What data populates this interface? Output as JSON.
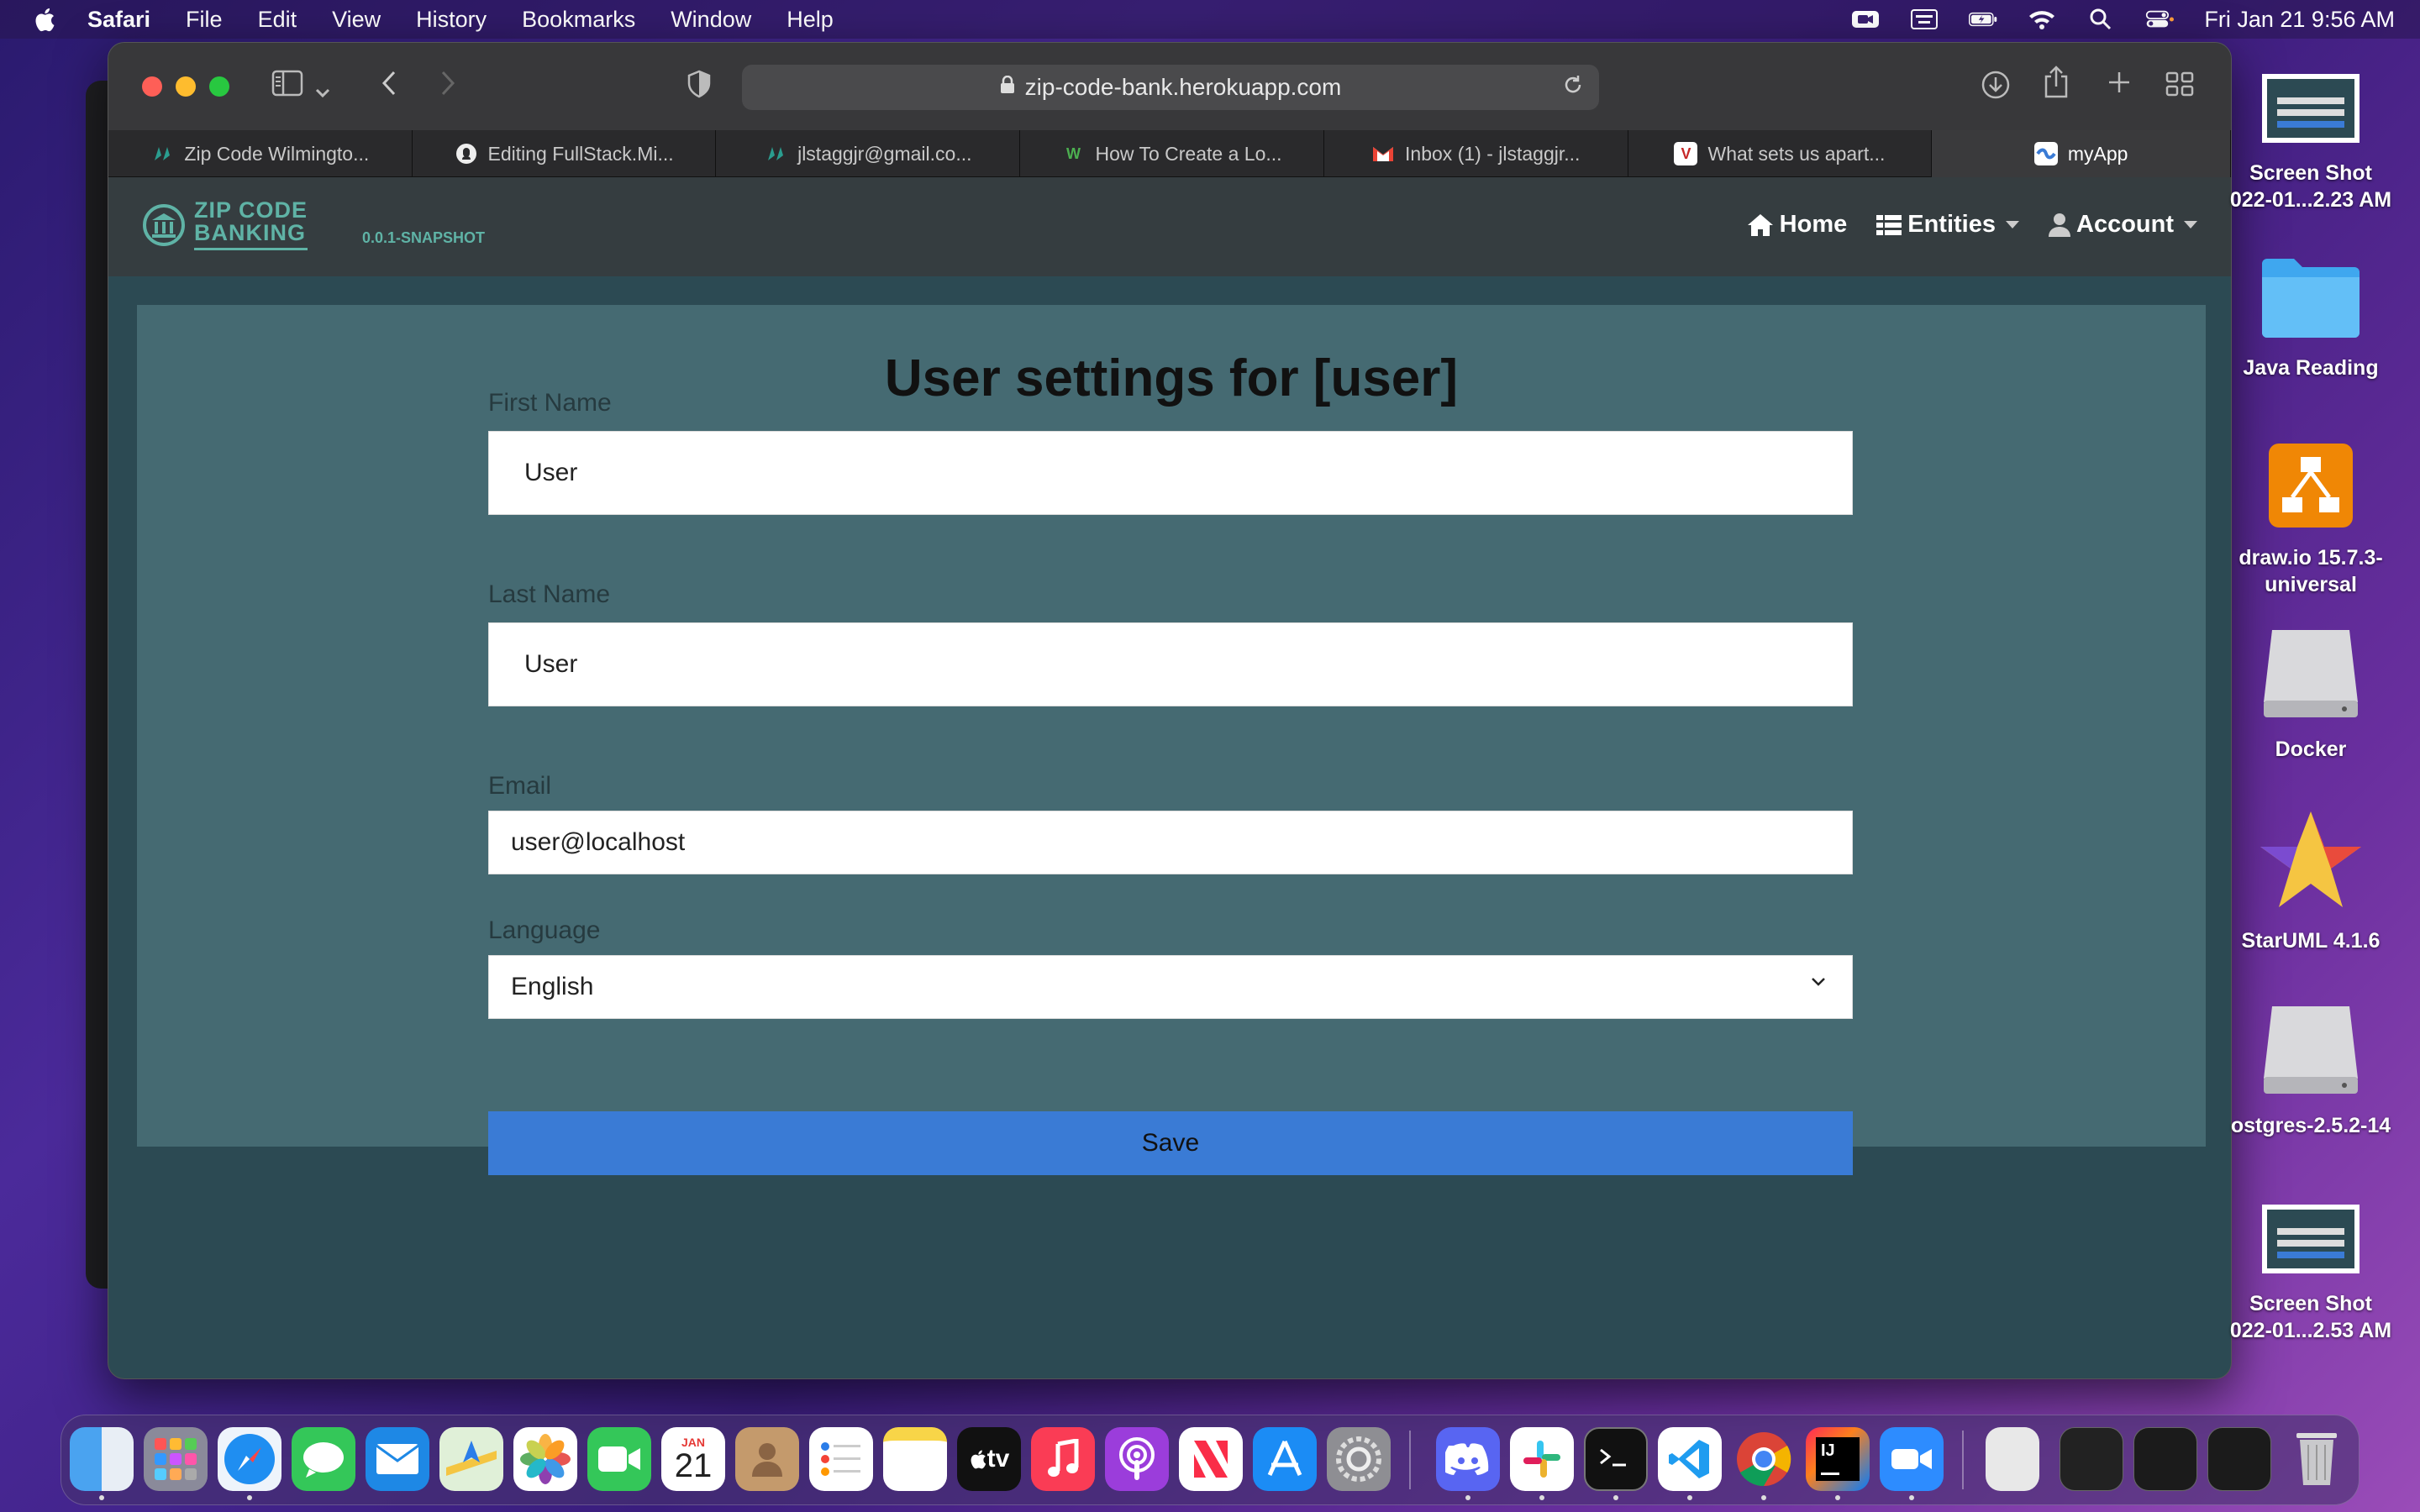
{
  "menubar": {
    "app_name": "Safari",
    "items": [
      "File",
      "Edit",
      "View",
      "History",
      "Bookmarks",
      "Window",
      "Help"
    ],
    "datetime": "Fri Jan 21  9:56 AM"
  },
  "browser": {
    "url": "zip-code-bank.herokuapp.com",
    "tabs": [
      {
        "label": "Zip Code Wilmingto...",
        "icon": "zipcode-favicon"
      },
      {
        "label": "Editing FullStack.Mi...",
        "icon": "github-favicon"
      },
      {
        "label": "jlstaggjr@gmail.co...",
        "icon": "zipcode-favicon"
      },
      {
        "label": "How To Create a Lo...",
        "icon": "w-favicon"
      },
      {
        "label": "Inbox (1) - jlstaggjr...",
        "icon": "gmail-favicon"
      },
      {
        "label": "What sets us apart...",
        "icon": "v-favicon"
      },
      {
        "label": "myApp",
        "icon": "app-favicon"
      }
    ]
  },
  "app": {
    "logo_line1": "ZIP CODE",
    "logo_line2": "BANKING",
    "version": "0.0.1-SNAPSHOT",
    "nav": {
      "home": "Home",
      "entities": "Entities",
      "account": "Account"
    }
  },
  "settings": {
    "title_prefix": "User settings for [",
    "title_user": "user",
    "title_suffix": "]",
    "first_name_label": "First Name",
    "first_name_value": "User",
    "last_name_label": "Last Name",
    "last_name_value": "User",
    "email_label": "Email",
    "email_value": "user@localhost",
    "language_label": "Language",
    "language_value": "English",
    "save_label": "Save"
  },
  "desktop": {
    "items": [
      {
        "line1": "Screen Shot",
        "line2": "022-01...2.23 AM"
      },
      {
        "line1": "Java Reading",
        "line2": ""
      },
      {
        "line1": "draw.io 15.7.3-",
        "line2": "universal"
      },
      {
        "line1": "Docker",
        "line2": ""
      },
      {
        "line1": "StarUML 4.1.6",
        "line2": ""
      },
      {
        "line1": "ostgres-2.5.2-14",
        "line2": ""
      },
      {
        "line1": "Screen Shot",
        "line2": "022-01...2.53 AM"
      }
    ]
  },
  "dock": {
    "calendar_month": "JAN",
    "calendar_day": "21",
    "tv_label": "tv"
  },
  "colors": {
    "panel": "#456a72",
    "save_button": "#3a7bd5",
    "logo": "#5fb3a6"
  }
}
